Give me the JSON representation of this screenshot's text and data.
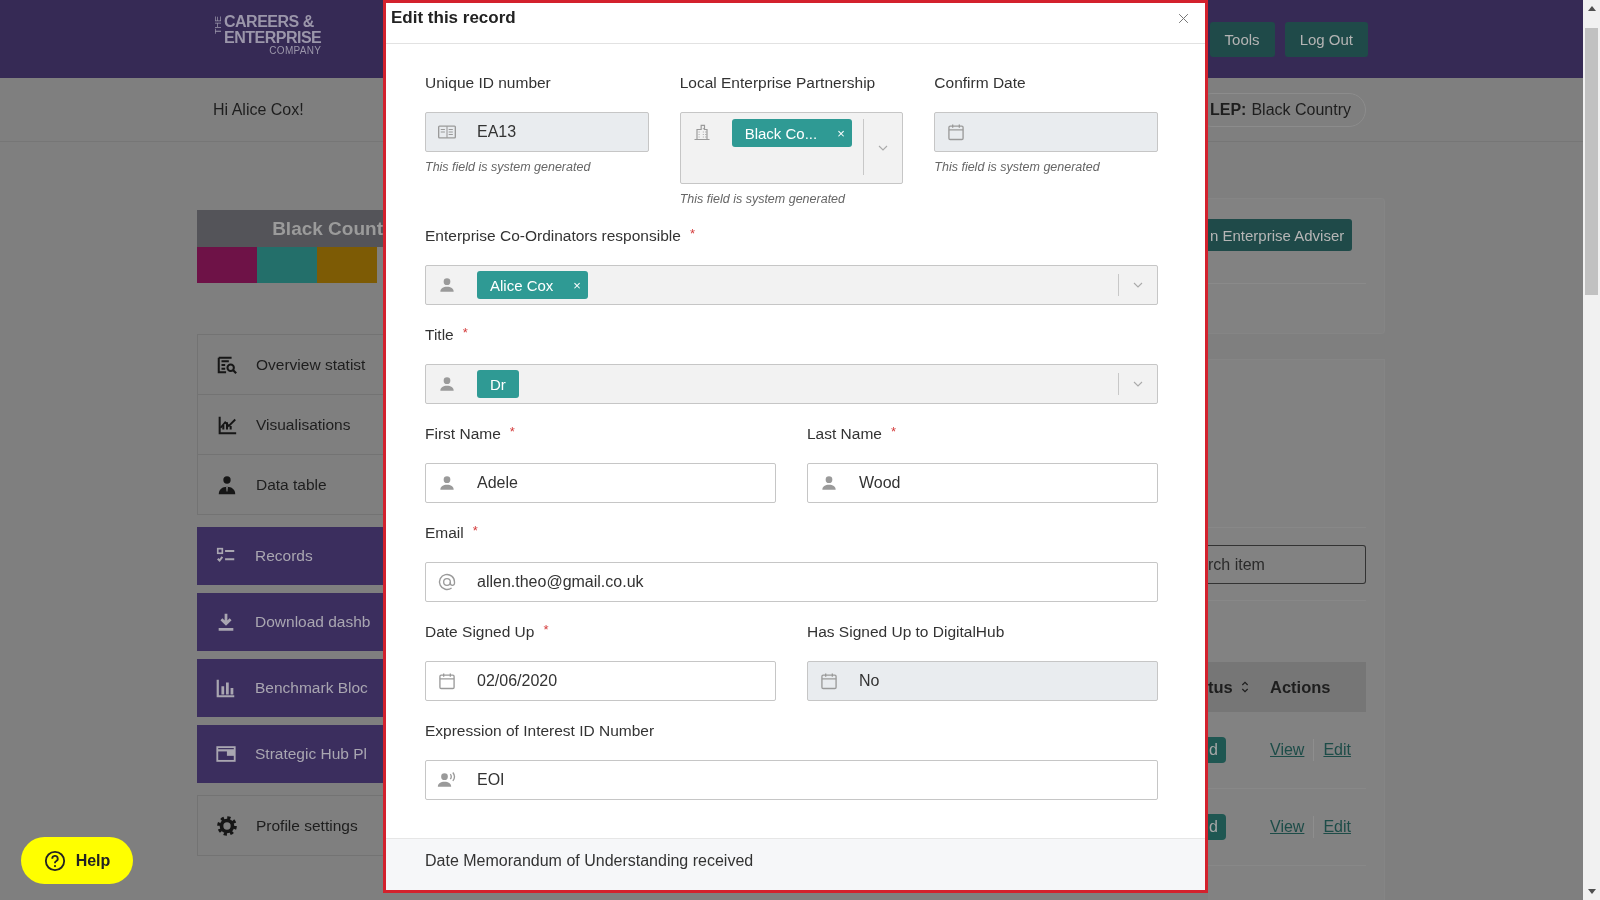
{
  "header": {
    "logo": {
      "small": "THE",
      "lines": [
        "CAREERS &",
        "ENTERPRISE",
        "COMPANY"
      ]
    },
    "buttons": [
      "Tools",
      "Log Out"
    ]
  },
  "greeting": "Hi Alice Cox!",
  "lep": {
    "label": "LEP:",
    "value": "Black Country"
  },
  "region_card": {
    "title": "Black Count",
    "stripes": [
      {
        "color": "#6e1247"
      },
      {
        "color": "#236f6a"
      },
      {
        "color": "#7d5b05"
      }
    ]
  },
  "sidebar": {
    "groups": [
      {
        "kind": "light",
        "items": [
          "Overview statist",
          "Visualisations",
          "Data table"
        ]
      },
      {
        "kind": "dark",
        "items": [
          "Records",
          "Download dashb",
          "Benchmark Bloc",
          "Strategic Hub Pl"
        ]
      },
      {
        "kind": "light",
        "items": [
          "Profile settings"
        ]
      }
    ]
  },
  "add_button": "n Enterprise Adviser",
  "search": {
    "placeholder": "rch item"
  },
  "table": {
    "columns": [
      "tus",
      "Actions"
    ],
    "rows": [
      {
        "status": "d",
        "actions": [
          "View",
          "Edit"
        ]
      },
      {
        "status": "d",
        "actions": [
          "View",
          "Edit"
        ]
      }
    ]
  },
  "help": "Help",
  "modal": {
    "title": "Edit this record",
    "rows": [
      {
        "fields": [
          {
            "label": "Unique ID number",
            "kind": "input",
            "value": "EA13",
            "disabled": true,
            "helper": "This field is system generated"
          },
          {
            "label": "Local Enterprise Partnership",
            "kind": "tags",
            "tags": [
              {
                "label": "Black Co...",
                "remove": "×"
              }
            ],
            "helper": "This field is system generated"
          },
          {
            "label": "Confirm Date",
            "kind": "input",
            "disabled": true,
            "helper": "This field is system generated"
          }
        ]
      },
      {
        "fields": [
          {
            "label": "Enterprise Co-Ordinators responsible",
            "required_mark": "*",
            "kind": "tags",
            "tags": [
              {
                "label": "Alice Cox",
                "remove": "×"
              }
            ]
          }
        ]
      },
      {
        "fields": [
          {
            "label": "Title",
            "required_mark": "*",
            "kind": "tags",
            "tags": [
              {
                "label": "Dr"
              }
            ]
          }
        ]
      },
      {
        "fields": [
          {
            "label": "First Name",
            "required_mark": "*",
            "kind": "input",
            "value": "Adele",
            "disabled": false
          },
          {
            "label": "Last Name",
            "required_mark": "*",
            "kind": "input",
            "value": "Wood",
            "disabled": false
          }
        ]
      },
      {
        "fields": [
          {
            "label": "Email",
            "required_mark": "*",
            "kind": "input",
            "value": "allen.theo@gmail.co.uk",
            "disabled": false
          }
        ]
      },
      {
        "fields": [
          {
            "label": "Date Signed Up",
            "required_mark": "*",
            "kind": "input",
            "value": "02/06/2020",
            "disabled": false
          },
          {
            "label": "Has Signed Up to DigitalHub",
            "kind": "input",
            "value": "No",
            "disabled": true
          }
        ]
      },
      {
        "fields": [
          {
            "label": "Expression of Interest ID Number",
            "kind": "input",
            "value": "EOI",
            "disabled": false
          }
        ]
      }
    ],
    "footer_label": "Date Memorandum of Understanding received"
  }
}
